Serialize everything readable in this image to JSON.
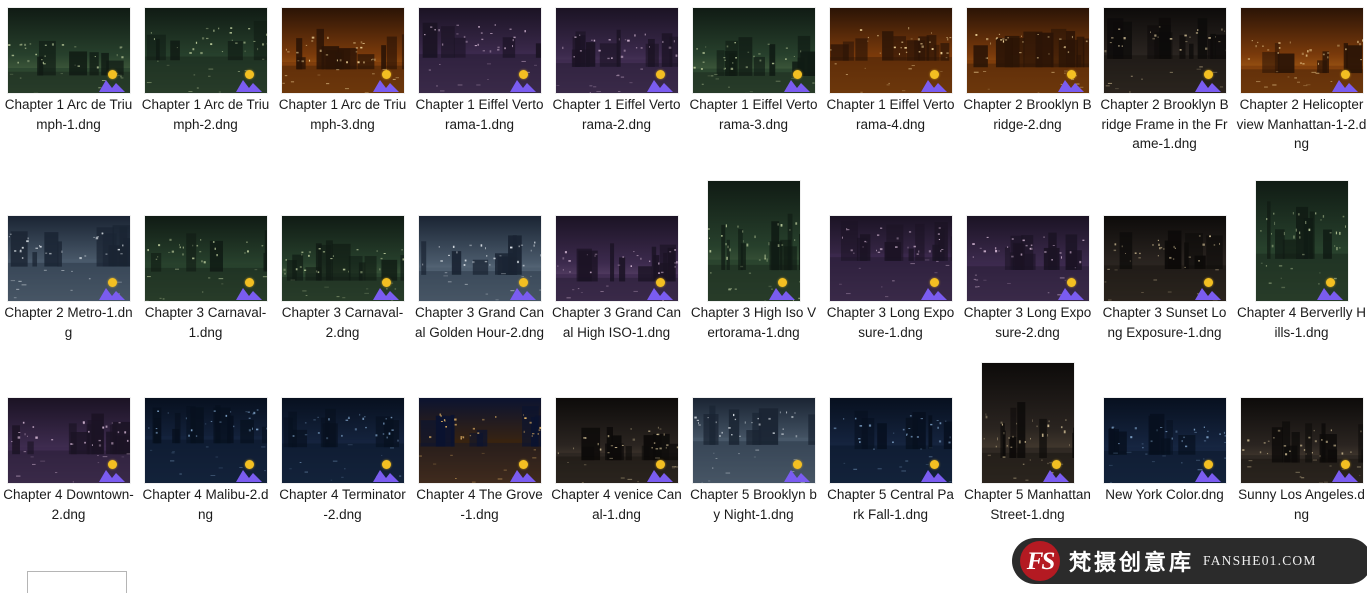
{
  "view": {
    "background": "#ffffff",
    "columns": 10,
    "rows": 3,
    "icon_badge": {
      "name": "lightroom-image-badge",
      "sun_color": "#f3bf22",
      "mountain_color": "#7a5cf0"
    }
  },
  "files": [
    {
      "label": "Chapter 1 Arc de Triumph-1.dng",
      "icon": "photo-thumbnail",
      "orientation": "landscape",
      "col": 0,
      "row": 0
    },
    {
      "label": "Chapter 1 Arc de Triumph-2.dng",
      "icon": "photo-thumbnail",
      "orientation": "landscape",
      "col": 1,
      "row": 0
    },
    {
      "label": "Chapter 1 Arc de Triumph-3.dng",
      "icon": "photo-thumbnail",
      "orientation": "landscape",
      "col": 2,
      "row": 0
    },
    {
      "label": "Chapter 1 Eiffel Vertorama-1.dng",
      "icon": "photo-thumbnail",
      "orientation": "landscape",
      "col": 3,
      "row": 0
    },
    {
      "label": "Chapter 1 Eiffel Vertorama-2.dng",
      "icon": "photo-thumbnail",
      "orientation": "landscape",
      "col": 4,
      "row": 0
    },
    {
      "label": "Chapter 1 Eiffel Vertorama-3.dng",
      "icon": "photo-thumbnail",
      "orientation": "landscape",
      "col": 5,
      "row": 0
    },
    {
      "label": "Chapter 1 Eiffel Vertorama-4.dng",
      "icon": "photo-thumbnail",
      "orientation": "landscape",
      "col": 6,
      "row": 0
    },
    {
      "label": "Chapter 2 Brooklyn Bridge-2.dng",
      "icon": "photo-thumbnail",
      "orientation": "landscape",
      "col": 7,
      "row": 0
    },
    {
      "label": "Chapter 2 Brooklyn Bridge Frame in the Frame-1.dng",
      "icon": "photo-thumbnail",
      "orientation": "landscape",
      "col": 8,
      "row": 0
    },
    {
      "label": "Chapter 2 Helicopter view Manhattan-1-2.dng",
      "icon": "photo-thumbnail",
      "orientation": "landscape",
      "col": 9,
      "row": 0
    },
    {
      "label": "Chapter 2 Metro-1.dng",
      "icon": "photo-thumbnail",
      "orientation": "landscape",
      "col": 0,
      "row": 1
    },
    {
      "label": "Chapter 3 Carnaval-1.dng",
      "icon": "photo-thumbnail",
      "orientation": "landscape",
      "col": 1,
      "row": 1
    },
    {
      "label": "Chapter 3 Carnaval-2.dng",
      "icon": "photo-thumbnail",
      "orientation": "landscape",
      "col": 2,
      "row": 1
    },
    {
      "label": "Chapter 3 Grand Canal Golden Hour-2.dng",
      "icon": "photo-thumbnail",
      "orientation": "landscape",
      "col": 3,
      "row": 1
    },
    {
      "label": "Chapter 3 Grand Canal High ISO-1.dng",
      "icon": "photo-thumbnail",
      "orientation": "landscape",
      "col": 4,
      "row": 1
    },
    {
      "label": "Chapter 3 High Iso Vertorama-1.dng",
      "icon": "photo-thumbnail",
      "orientation": "portrait",
      "col": 5,
      "row": 1
    },
    {
      "label": "Chapter 3 Long Exposure-1.dng",
      "icon": "photo-thumbnail",
      "orientation": "landscape",
      "col": 6,
      "row": 1
    },
    {
      "label": "Chapter 3 Long Exposure-2.dng",
      "icon": "photo-thumbnail",
      "orientation": "landscape",
      "col": 7,
      "row": 1
    },
    {
      "label": "Chapter 3 Sunset Long Exposure-1.dng",
      "icon": "photo-thumbnail",
      "orientation": "landscape",
      "col": 8,
      "row": 1
    },
    {
      "label": "Chapter 4 Berverlly Hills-1.dng",
      "icon": "photo-thumbnail",
      "orientation": "portrait",
      "col": 9,
      "row": 1
    },
    {
      "label": "Chapter 4 Downtown-2.dng",
      "icon": "photo-thumbnail",
      "orientation": "landscape",
      "col": 0,
      "row": 2
    },
    {
      "label": "Chapter 4 Malibu-2.dng",
      "icon": "photo-thumbnail",
      "orientation": "landscape",
      "col": 1,
      "row": 2
    },
    {
      "label": "Chapter 4 Terminator-2.dng",
      "icon": "photo-thumbnail",
      "orientation": "landscape",
      "col": 2,
      "row": 2
    },
    {
      "label": "Chapter 4 The Grove-1.dng",
      "icon": "photo-thumbnail",
      "orientation": "landscape",
      "col": 3,
      "row": 2
    },
    {
      "label": "Chapter 4 venice Canal-1.dng",
      "icon": "photo-thumbnail",
      "orientation": "landscape",
      "col": 4,
      "row": 2
    },
    {
      "label": "Chapter 5 Brooklyn by Night-1.dng",
      "icon": "photo-thumbnail",
      "orientation": "landscape",
      "col": 5,
      "row": 2
    },
    {
      "label": "Chapter 5 Central Park Fall-1.dng",
      "icon": "photo-thumbnail",
      "orientation": "landscape",
      "col": 6,
      "row": 2
    },
    {
      "label": "Chapter 5 Manhattan Street-1.dng",
      "icon": "photo-thumbnail",
      "orientation": "portrait",
      "col": 7,
      "row": 2
    },
    {
      "label": "New York Color.dng",
      "icon": "photo-thumbnail",
      "orientation": "landscape",
      "col": 8,
      "row": 2
    },
    {
      "label": "Sunny Los Angeles.dng",
      "icon": "photo-thumbnail",
      "orientation": "landscape",
      "col": 9,
      "row": 2
    }
  ],
  "bottom_input": {
    "value": "",
    "placeholder": ""
  },
  "watermark": {
    "logo_text": "FS",
    "brand_cn": "梵摄创意库",
    "url": "FANSHE01.COM",
    "bg": "#2b2b2b",
    "logo_bg": "#b41a22"
  }
}
